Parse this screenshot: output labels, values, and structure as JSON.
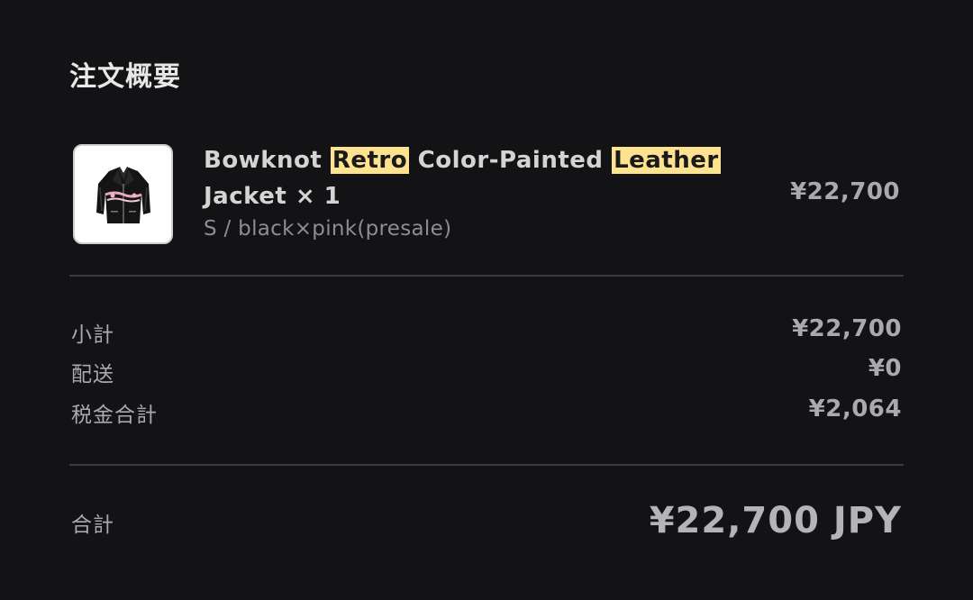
{
  "summary": {
    "heading": "注文概要"
  },
  "item": {
    "name_parts": [
      {
        "text": "Bowknot ",
        "highlight": false
      },
      {
        "text": "Retro",
        "highlight": true
      },
      {
        "text": " Color-Painted ",
        "highlight": false
      },
      {
        "text": "Leather",
        "highlight": true
      },
      {
        "text": " Jacket × 1",
        "highlight": false
      }
    ],
    "variant": "S / black×pink(presale)",
    "price": "¥22,700",
    "image_icon": "leather-jacket-image",
    "highlight_color": "#fde28f"
  },
  "totals": {
    "subtotal_label": "小計",
    "subtotal_value": "¥22,700",
    "shipping_label": "配送",
    "shipping_value": "¥0",
    "tax_label": "税金合計",
    "tax_value": "¥2,064",
    "total_label": "合計",
    "total_value": "¥22,700 JPY"
  },
  "colors": {
    "background": "#131215",
    "divider": "#3c3c40",
    "muted_text": "#a9a9ae"
  }
}
